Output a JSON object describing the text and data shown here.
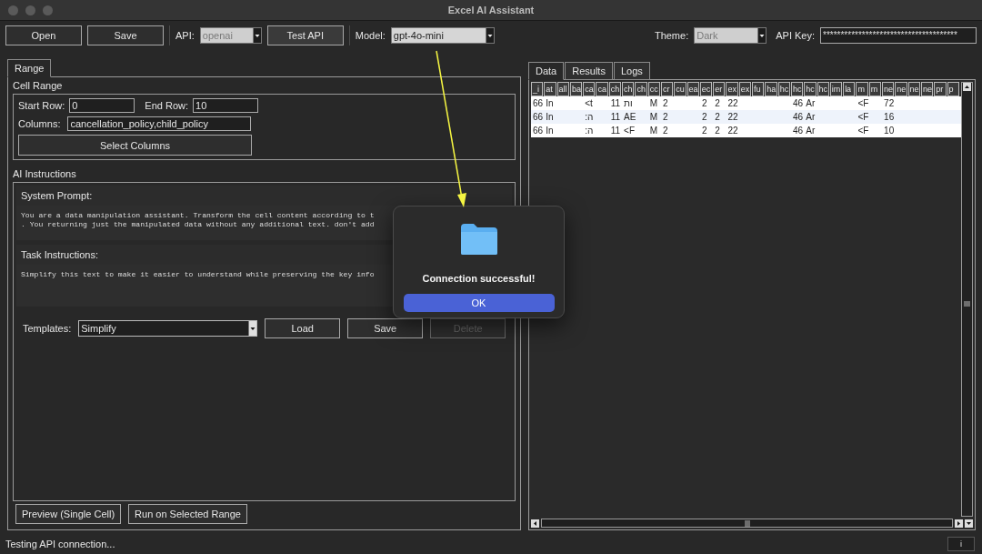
{
  "window": {
    "title": "Excel AI Assistant"
  },
  "toolbar": {
    "open_button": "Open",
    "save_button": "Save",
    "api": {
      "label": "API:",
      "value": "openai"
    },
    "test_button": "Test API",
    "model": {
      "label": "Model:",
      "value": "gpt-4o-mini"
    },
    "theme": {
      "label": "Theme:",
      "value": "Dark"
    },
    "api_key": {
      "label": "API Key:",
      "value": "**************************************"
    }
  },
  "left_tabs": [
    {
      "label": "Range",
      "selected": true
    }
  ],
  "cell_range": {
    "title": "Cell Range",
    "start_row": {
      "label": "Start Row:",
      "value": "0"
    },
    "end_row": {
      "label": "End Row:",
      "value": "10"
    },
    "columns": {
      "label": "Columns:",
      "value": "cancellation_policy,child_policy"
    },
    "select_button": "Select Columns"
  },
  "ai_instructions": {
    "title": "AI Instructions",
    "system_prompt": {
      "label": "System Prompt:",
      "lines": [
        "You are a data manipulation assistant. Transform the cell content according to t",
        ". You returning just the manipulated data without any additional text. don't add"
      ]
    },
    "task": {
      "label": "Task Instructions:",
      "lines": [
        "Simplify this text to make it easier to understand while preserving the key info"
      ]
    },
    "templates": {
      "label": "Templates:",
      "value": "Simplify"
    },
    "buttons": [
      {
        "label": "Load",
        "disabled": false
      },
      {
        "label": "Save",
        "disabled": false
      },
      {
        "label": "Delete",
        "disabled": true
      }
    ]
  },
  "run_buttons": [
    "Preview (Single Cell)",
    "Run on Selected Range"
  ],
  "right_tabs": [
    {
      "label": "Data",
      "selected": true
    },
    {
      "label": "Results",
      "selected": false
    },
    {
      "label": "Logs",
      "selected": false
    }
  ],
  "table": {
    "columns": [
      "_i",
      "at",
      "all",
      "ba",
      "ca",
      "ca",
      "ch",
      "ch",
      "ch",
      "cc",
      "cr",
      "cu",
      "ea",
      "ec",
      "er",
      "ex",
      "ex",
      "fu",
      "ha",
      "hc",
      "hc",
      "hc",
      "hc",
      "im",
      "la",
      "m",
      "m",
      "ne",
      "ne",
      "ne",
      "ne",
      "pr",
      "p"
    ],
    "rows": [
      [
        "66",
        "In",
        "",
        "",
        "<t",
        "",
        "11",
        "ות",
        "",
        "M",
        "2",
        "",
        "",
        "2",
        "2",
        "22",
        "",
        "",
        "",
        "",
        "46",
        "Ar",
        "",
        "",
        "",
        "<F",
        "",
        "72",
        "",
        "",
        "",
        "",
        ""
      ],
      [
        "66",
        "In",
        "",
        "",
        ":ה",
        "",
        "11",
        "AE",
        "",
        "M",
        "2",
        "",
        "",
        "2",
        "2",
        "22",
        "",
        "",
        "",
        "",
        "46",
        "Ar",
        "",
        "",
        "",
        "<F",
        "",
        "16",
        "",
        "",
        "",
        "",
        ""
      ],
      [
        "66",
        "In",
        "",
        "",
        ":ה",
        "",
        "11",
        "<F",
        "",
        "M",
        "2",
        "",
        "",
        "2",
        "2",
        "22",
        "",
        "",
        "",
        "",
        "46",
        "Ar",
        "",
        "",
        "",
        "<F",
        "",
        "10",
        "",
        "",
        "",
        "",
        ""
      ]
    ]
  },
  "dialog": {
    "message": "Connection successful!",
    "button": "OK"
  },
  "status_bar": {
    "text": "Testing API connection...",
    "info_button": "i"
  }
}
